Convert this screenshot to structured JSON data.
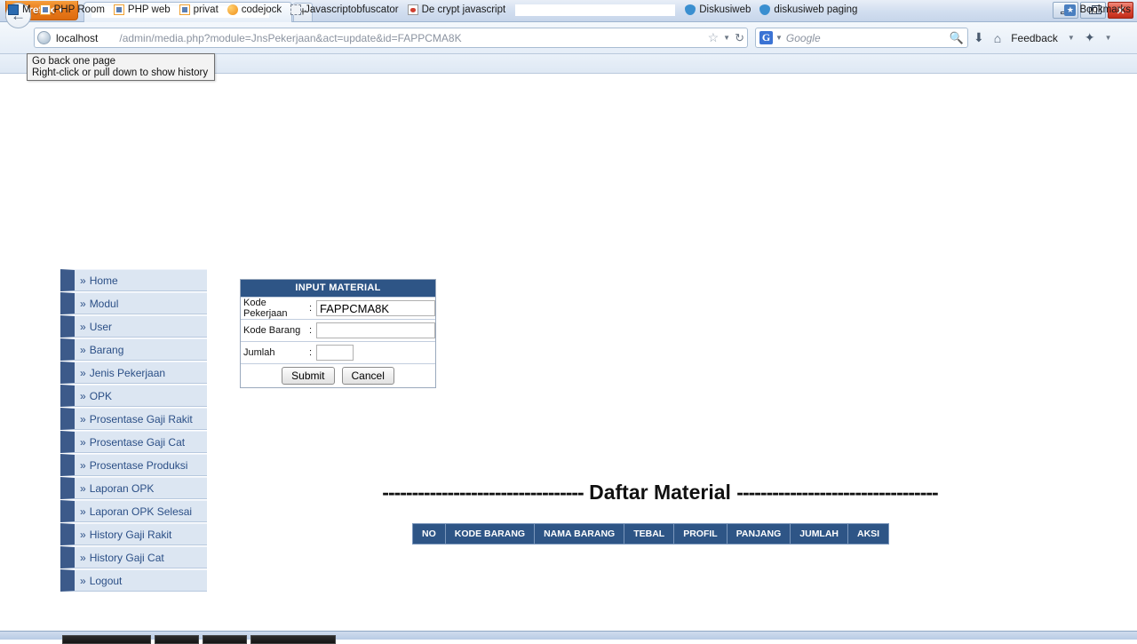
{
  "browser": {
    "app_button": "Firefox",
    "tab_title": "",
    "new_tab": "+",
    "back_icon": "back-arrow-icon",
    "url_host": "localhost",
    "url_path": "/admin/media.php?module=JnsPekerjaan&act=update&id=FAPPCMA8K",
    "search_engine": "G",
    "search_placeholder": "Google",
    "feedback_label": "Feedback",
    "tooltip": {
      "line1": "Go back one page",
      "line2": "Right-click or pull down to show history"
    },
    "window_controls": {
      "minimize": "minimize-button",
      "maximize": "maximize-button",
      "close": "close-button"
    },
    "bookmarks_left": [
      {
        "label": "M",
        "icon": "magnifier-favicon",
        "style": "fav-blue"
      },
      {
        "label": "PHP Room",
        "icon": "code-favicon",
        "style": "fav-orange"
      },
      {
        "label": "PHP web",
        "icon": "code-favicon",
        "style": "fav-orange"
      },
      {
        "label": "privat",
        "icon": "code-favicon",
        "style": "fav-orange"
      },
      {
        "label": "codejock",
        "icon": "circle-favicon",
        "style": "fav-circle"
      },
      {
        "label": "Javascriptobfuscator",
        "icon": "placeholder-favicon",
        "style": "fav-dash"
      },
      {
        "label": "De crypt javascript",
        "icon": "devil-favicon",
        "style": "fav-devil"
      }
    ],
    "bookmarks_right": [
      {
        "label": "Diskusiweb",
        "icon": "shield-favicon",
        "style": "fav-shield"
      },
      {
        "label": "diskusiweb paging",
        "icon": "shield-favicon",
        "style": "fav-shield"
      }
    ],
    "bookmarks_menu_label": "Bookmarks"
  },
  "page": {
    "sidebar": {
      "items": [
        {
          "label": "Home"
        },
        {
          "label": "Modul"
        },
        {
          "label": "User"
        },
        {
          "label": "Barang"
        },
        {
          "label": "Jenis Pekerjaan"
        },
        {
          "label": "OPK"
        },
        {
          "label": "Prosentase Gaji Rakit"
        },
        {
          "label": "Prosentase Gaji Cat"
        },
        {
          "label": "Prosentase Produksi"
        },
        {
          "label": "Laporan OPK"
        },
        {
          "label": "Laporan OPK Selesai"
        },
        {
          "label": "History Gaji Rakit"
        },
        {
          "label": "History Gaji Cat"
        },
        {
          "label": "Logout"
        }
      ],
      "bullet": "»"
    },
    "form": {
      "title": "INPUT MATERIAL",
      "separator": ":",
      "fields": [
        {
          "label": "Kode Pekerjaan",
          "value": "FAPPCMA8K",
          "placeholder": ""
        },
        {
          "label": "Kode Barang",
          "value": "",
          "placeholder": ""
        },
        {
          "label": "Jumlah",
          "value": "",
          "placeholder": ""
        }
      ],
      "submit_label": "Submit",
      "cancel_label": "Cancel"
    },
    "daftar": {
      "dashes_left": "----------------------------------",
      "title": "Daftar Material",
      "dashes_right": "----------------------------------"
    },
    "table": {
      "headers": [
        "NO",
        "KODE BARANG",
        "NAMA BARANG",
        "TEBAL",
        "PROFIL",
        "PANJANG",
        "JUMLAH",
        "AKSI"
      ],
      "rows": []
    }
  },
  "colors": {
    "header_blue": "#2e5586",
    "sidebar_block": "#3c5a8a",
    "sidebar_bg": "#dce6f2",
    "sidebar_text": "#2b4f86",
    "firefox_orange": "#e8791a"
  }
}
